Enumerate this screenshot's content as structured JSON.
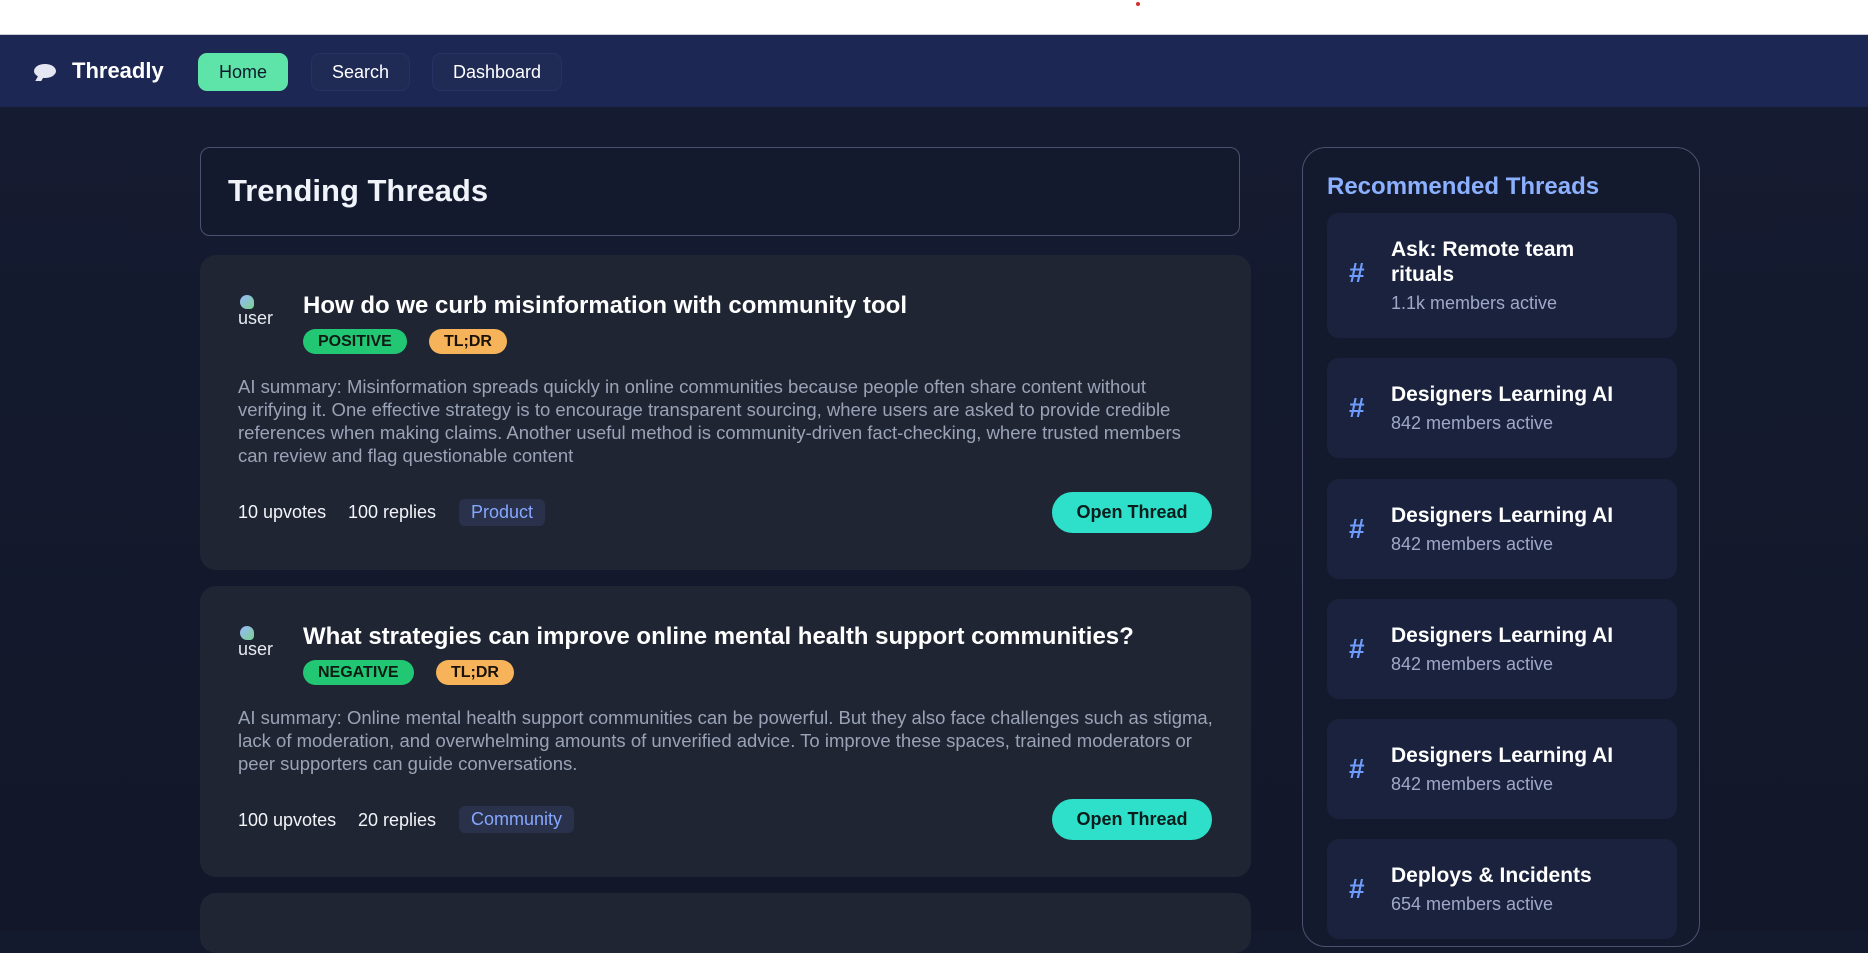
{
  "brand": {
    "name": "Threadly",
    "icon": "speech-bubble-icon"
  },
  "nav": {
    "items": [
      {
        "label": "Home",
        "active": true
      },
      {
        "label": "Search",
        "active": false
      },
      {
        "label": "Dashboard",
        "active": false
      }
    ]
  },
  "main": {
    "title": "Trending Threads",
    "threads": [
      {
        "avatar_alt": "user",
        "title": "How do we curb misinformation with community tool",
        "sentiment": "POSITIVE",
        "tldr": "TL;DR",
        "summary": "AI summary: Misinformation spreads quickly in online communities because people often share content without verifying it. One effective strategy is to encourage transparent sourcing, where users are asked to provide credible references when making claims. Another useful method is community-driven fact-checking, where trusted members can review and flag questionable content",
        "upvotes": "10 upvotes",
        "replies": "100 replies",
        "tag": "Product",
        "open_label": "Open Thread"
      },
      {
        "avatar_alt": "user",
        "title": "What strategies can improve online mental health support communities?",
        "sentiment": "NEGATIVE",
        "tldr": "TL;DR",
        "summary": "AI summary: Online mental health support communities can be powerful. But they also face challenges such as stigma, lack of moderation, and overwhelming amounts of unverified advice. To improve these spaces, trained moderators or peer supporters can guide conversations.",
        "upvotes": "100 upvotes",
        "replies": "20 replies",
        "tag": "Community",
        "open_label": "Open Thread"
      }
    ]
  },
  "sidebar": {
    "title": "Recommended Threads",
    "icon": "hash-icon",
    "items": [
      {
        "hash": "#",
        "title": "Ask: Remote team rituals",
        "meta": "1.1k members active"
      },
      {
        "hash": "#",
        "title": "Designers Learning AI",
        "meta": "842 members active"
      },
      {
        "hash": "#",
        "title": "Designers Learning AI",
        "meta": "842 members active"
      },
      {
        "hash": "#",
        "title": "Designers Learning AI",
        "meta": "842 members active"
      },
      {
        "hash": "#",
        "title": "Designers Learning AI",
        "meta": "842 members active"
      },
      {
        "hash": "#",
        "title": "Deploys & Incidents",
        "meta": "654 members active"
      }
    ]
  },
  "colors": {
    "accent_green": "#5ee3a8",
    "open_button": "#2ee0c9",
    "positive_badge": "#22c773",
    "tldr_badge": "#f6b35a",
    "sidebar_title": "#8bb0ff"
  }
}
